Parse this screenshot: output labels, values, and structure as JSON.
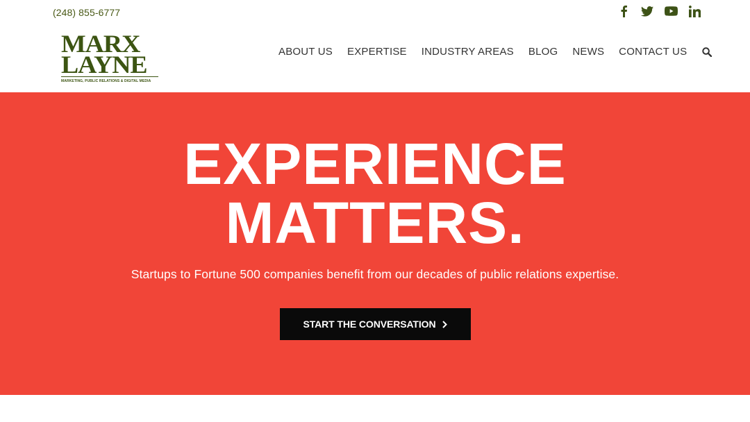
{
  "topbar": {
    "phone": "(248) 855-6777",
    "social": [
      {
        "name": "facebook-icon"
      },
      {
        "name": "twitter-icon"
      },
      {
        "name": "youtube-icon"
      },
      {
        "name": "linkedin-icon"
      }
    ]
  },
  "logo": {
    "line1": "MARX",
    "line2": "LAYNE",
    "tagline": "MARKETING, PUBLIC RELATIONS & DIGITAL MEDIA"
  },
  "nav": {
    "items": [
      "ABOUT US",
      "EXPERTISE",
      "INDUSTRY AREAS",
      "BLOG",
      "NEWS",
      "CONTACT US"
    ],
    "search_icon": "search-icon"
  },
  "hero": {
    "title_line1": "EXPERIENCE",
    "title_line2": "MATTERS.",
    "subtitle": "Startups to Fortune 500 companies benefit from our decades of public relations expertise.",
    "cta_label": "START THE CONVERSATION",
    "cta_icon": "chevron-right-icon"
  },
  "colors": {
    "brand_green": "#3c5412",
    "hero_red": "#f14538",
    "cta_black": "#0a0a0a"
  }
}
